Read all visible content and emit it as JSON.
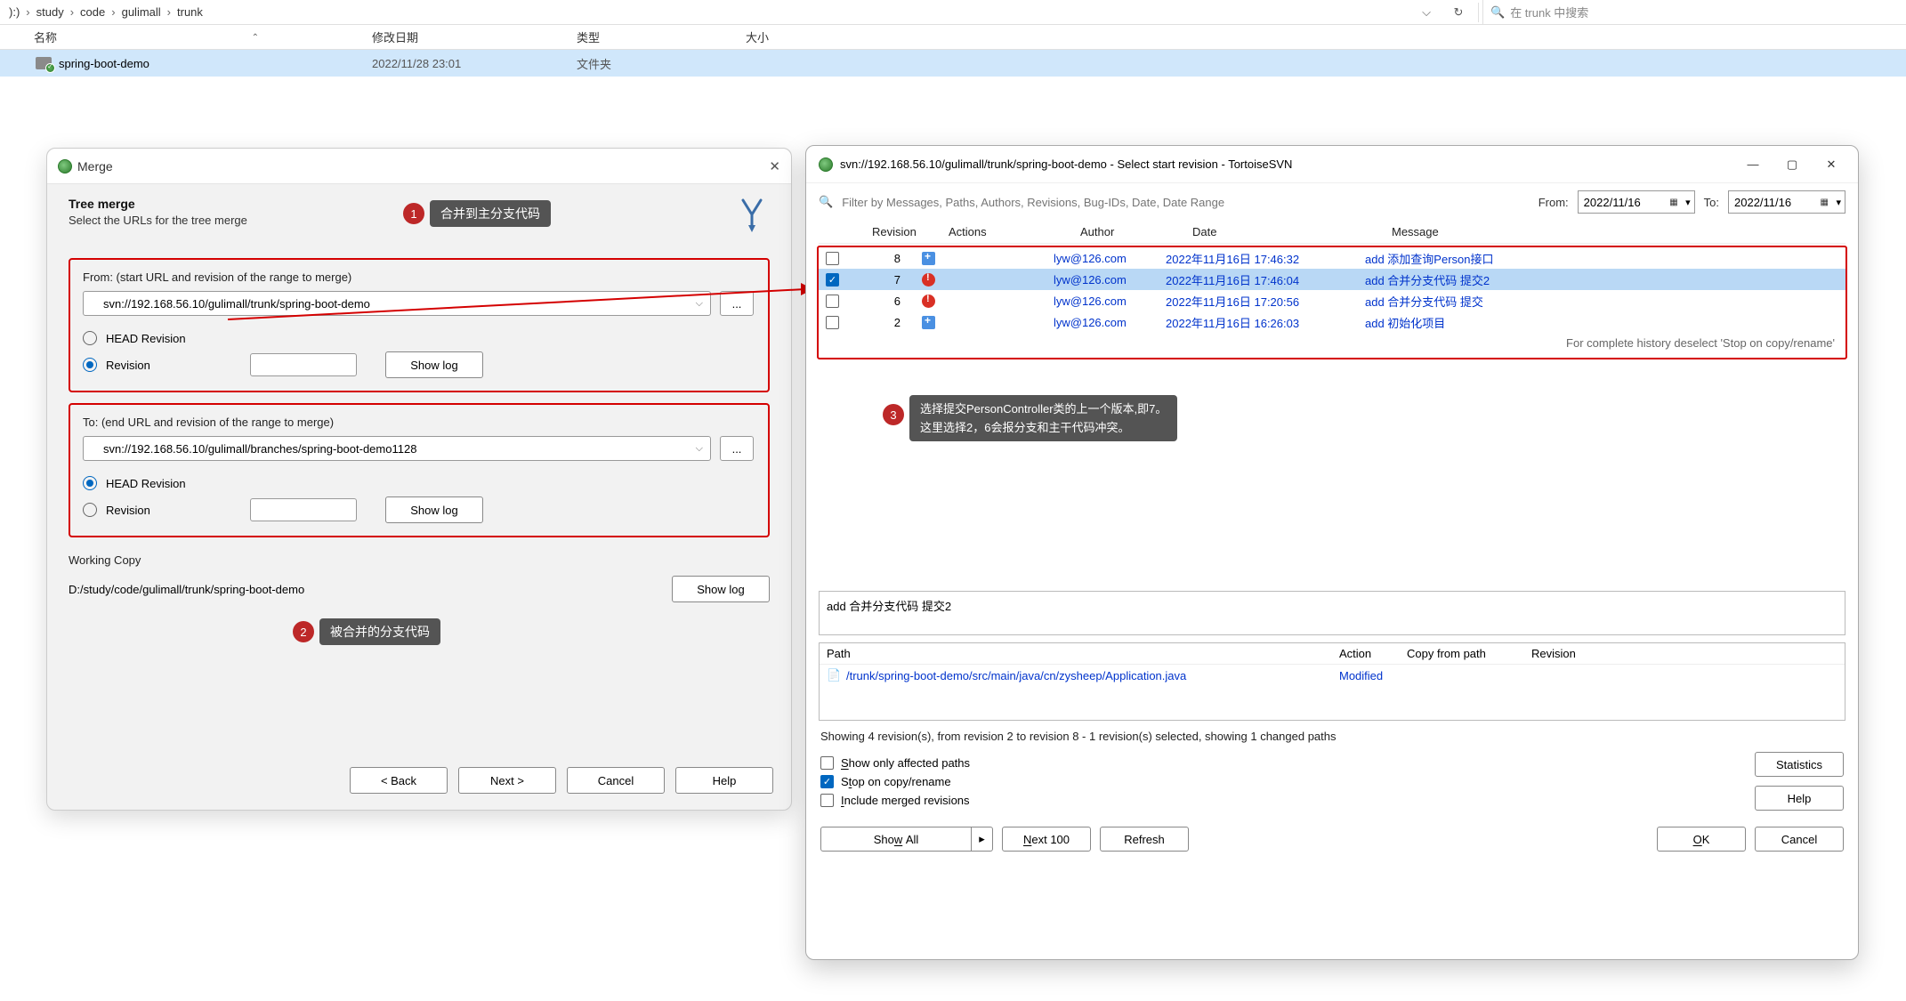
{
  "breadcrumb": {
    "root": "):)",
    "p1": "study",
    "p2": "code",
    "p3": "gulimall",
    "p4": "trunk"
  },
  "search_placeholder": "在 trunk 中搜索",
  "columns": {
    "name": "名称",
    "date": "修改日期",
    "type": "类型",
    "size": "大小"
  },
  "file": {
    "name": "spring-boot-demo",
    "date": "2022/11/28 23:01",
    "type": "文件夹"
  },
  "merge": {
    "title": "Merge",
    "heading": "Tree merge",
    "sub": "Select the URLs for the tree merge",
    "from_label": "From: (start URL and revision of the range to merge)",
    "from_url": "svn://192.168.56.10/gulimall/trunk/spring-boot-demo",
    "head_rev": "HEAD Revision",
    "revision": "Revision",
    "show_log": "Show log",
    "to_label": "To: (end URL and revision of the range to merge)",
    "to_url": "svn://192.168.56.10/gulimall/branches/spring-boot-demo1128",
    "wc_label": "Working Copy",
    "wc_path": "D:/study/code/gulimall/trunk/spring-boot-demo",
    "back": "< Back",
    "next": "Next >",
    "cancel": "Cancel",
    "help": "Help",
    "dots": "..."
  },
  "callouts": {
    "c1": "合并到主分支代码",
    "c2": "被合并的分支代码",
    "c3a": "选择提交PersonController类的上一个版本,即7。",
    "c3b": "这里选择2，6会报分支和主干代码冲突。"
  },
  "log": {
    "title": "svn://192.168.56.10/gulimall/trunk/spring-boot-demo - Select start revision - TortoiseSVN",
    "filter_placeholder": "Filter by Messages, Paths, Authors, Revisions, Bug-IDs, Date, Date Range",
    "from_lbl": "From:",
    "to_lbl": "To:",
    "from_date": "2022/11/16",
    "to_date": "2022/11/16",
    "head": {
      "rev": "Revision",
      "actions": "Actions",
      "author": "Author",
      "date": "Date",
      "msg": "Message"
    },
    "rows": [
      {
        "rev": "8",
        "author": "lyw@126.com",
        "date": "2022年11月16日 17:46:32",
        "msg": "add 添加查询Person接口",
        "icon": "add",
        "checked": false,
        "selected": false
      },
      {
        "rev": "7",
        "author": "lyw@126.com",
        "date": "2022年11月16日 17:46:04",
        "msg": "add 合并分支代码 提交2",
        "icon": "warn",
        "checked": true,
        "selected": true
      },
      {
        "rev": "6",
        "author": "lyw@126.com",
        "date": "2022年11月16日 17:20:56",
        "msg": "add 合并分支代码 提交",
        "icon": "warn",
        "checked": false,
        "selected": false
      },
      {
        "rev": "2",
        "author": "lyw@126.com",
        "date": "2022年11月16日 16:26:03",
        "msg": "add 初始化项目",
        "icon": "add",
        "checked": false,
        "selected": false
      }
    ],
    "history_note": "For complete history deselect 'Stop on copy/rename'",
    "selected_msg": "add 合并分支代码 提交2",
    "paths_head": {
      "path": "Path",
      "action": "Action",
      "copy": "Copy from path",
      "rev": "Revision"
    },
    "path_row": {
      "path": "/trunk/spring-boot-demo/src/main/java/cn/zysheep/Application.java",
      "action": "Modified"
    },
    "status": "Showing 4 revision(s), from revision 2 to revision 8 - 1 revision(s) selected, showing 1 changed paths",
    "cb1": "Show only affected paths",
    "cb2": "Stop on copy/rename",
    "cb3": "Include merged revisions",
    "btn_statistics": "Statistics",
    "btn_help": "Help",
    "btn_showall": "Show All",
    "btn_next100": "Next 100",
    "btn_refresh": "Refresh",
    "btn_ok": "OK",
    "btn_cancel": "Cancel"
  }
}
